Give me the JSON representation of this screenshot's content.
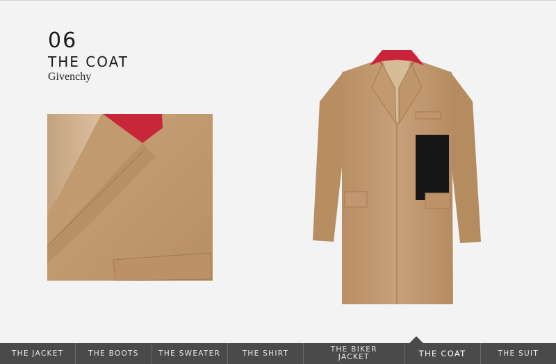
{
  "feature": {
    "number": "06",
    "title": "THE COAT",
    "brand": "Givenchy"
  },
  "images": {
    "detail": "coat-lapel-closeup-image",
    "product": "camel-coat-product-image"
  },
  "colors": {
    "camel": "#c39c73",
    "collar_red": "#c8263a",
    "nav_bg": "#4a4a4a"
  },
  "nav": {
    "items": [
      {
        "label": "THE JACKET"
      },
      {
        "label": "THE BOOTS"
      },
      {
        "label": "THE SWEATER"
      },
      {
        "label": "THE SHIRT"
      },
      {
        "label": "THE BIKER JACKET"
      },
      {
        "label": "THE COAT"
      },
      {
        "label": "THE SUIT"
      }
    ],
    "active": "THE COAT"
  }
}
